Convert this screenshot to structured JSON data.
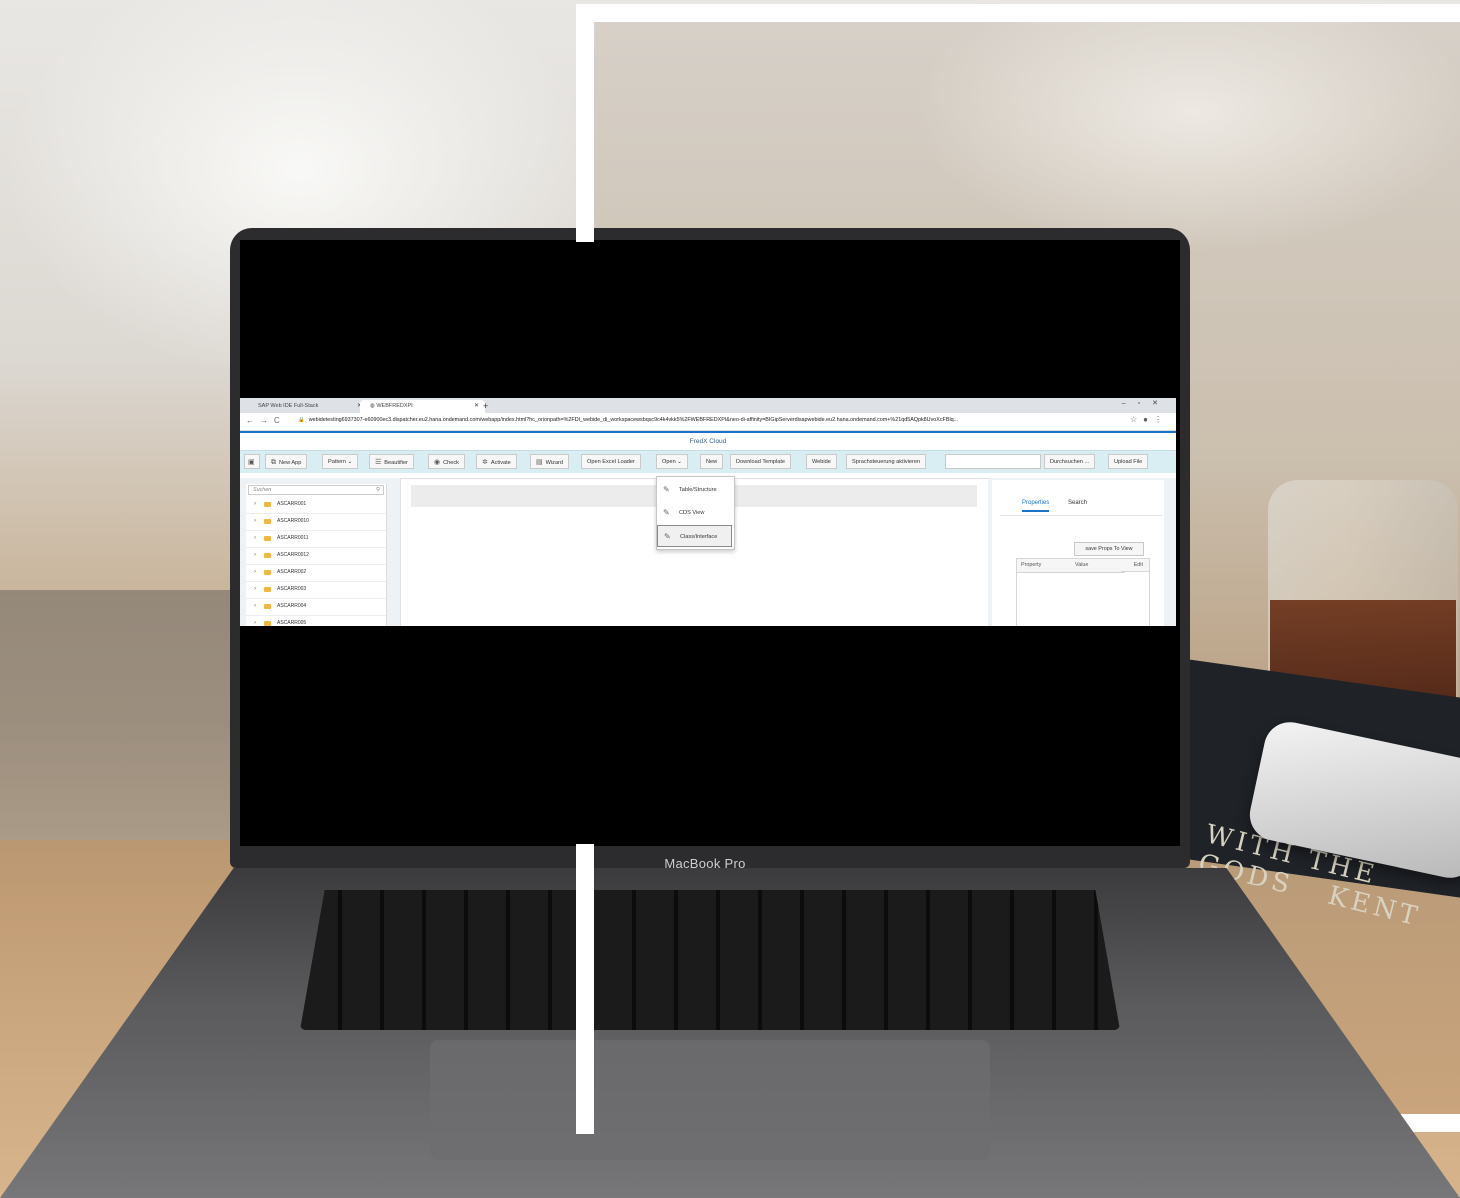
{
  "brand": "MacBook Pro",
  "book_title": "WITH THE GODS",
  "book_author": "KENT NE",
  "browser": {
    "tabs": [
      {
        "label": "SAP Web IDE Full-Stack"
      },
      {
        "label": "WEBFREDXPI"
      }
    ],
    "url": "webidetesting6937307-e60900ec3.dispatcher.eu2.hana.ondemand.com/webapp/index.html?hc_orionpath=%2FDI_webide_di_workspacewsbqsc9c4k4vkk5%2FWEBFREDXPI&neo-di-affinity=BIGipServerdisapwebide.eu2.hana.ondemand.com+%21qd5AQpk8UvoXcFBlq..."
  },
  "app": {
    "title": "FredX Cloud",
    "toolbar": {
      "new_app": "New App",
      "pattern": "Pattern",
      "beautifier": "Beautifier",
      "check": "Check",
      "activate": "Activate",
      "wizard": "Wizard",
      "open_excel_loader": "Open Excel Loader",
      "open": "Open",
      "new": "New",
      "download_template": "Download Template",
      "webide": "Webide",
      "sprachsteuerung": "Sprachsteuerung aktivieren",
      "durchsuchen": "Durchsuchen ...",
      "upload_file": "Upload File"
    },
    "sidebar": {
      "search_placeholder": "Suchen",
      "items": [
        "ASCARR001",
        "ASCARR0010",
        "ASCARR0011",
        "ASCARR0012",
        "ASCARR002",
        "ASCARR003",
        "ASCARR004",
        "ASCARR005"
      ]
    },
    "open_menu": {
      "items": [
        "Table/Structure",
        "CDS View",
        "Class/Interface"
      ],
      "selected": "Class/Interface"
    },
    "right_panel": {
      "tabs": [
        "Properties",
        "Search"
      ],
      "active_tab": "Properties",
      "save_button": "save Props To View",
      "columns": [
        "Property",
        "Value",
        "Edit"
      ]
    }
  }
}
